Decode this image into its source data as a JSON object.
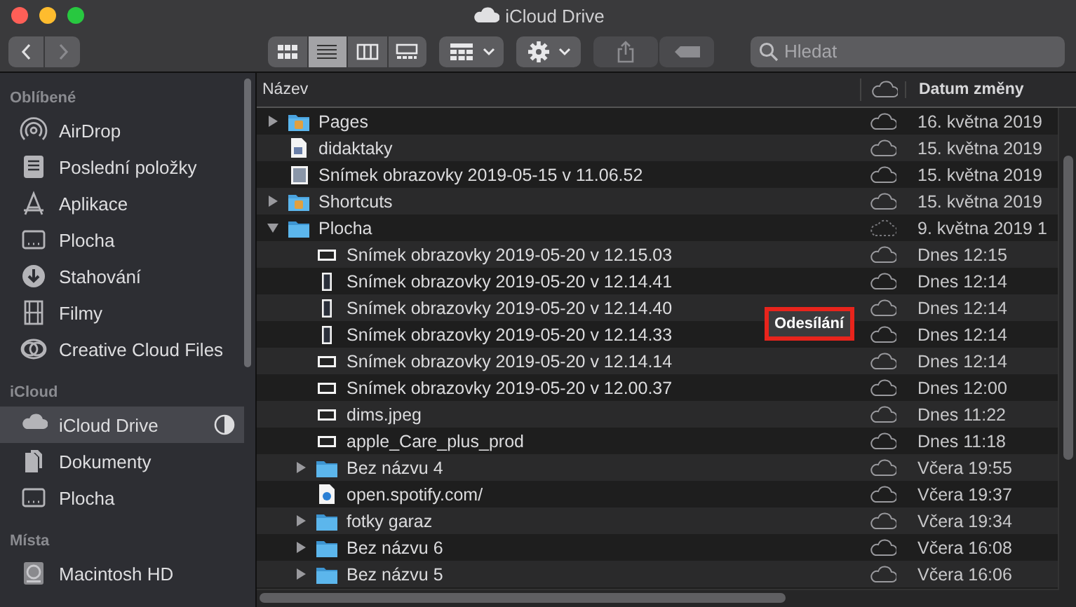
{
  "window": {
    "title": "iCloud Drive"
  },
  "toolbar": {
    "navigation": [
      {
        "kind": "back",
        "disabled": false
      },
      {
        "kind": "forward",
        "disabled": true
      }
    ],
    "view_modes": [
      {
        "kind": "icons",
        "selected": false
      },
      {
        "kind": "list",
        "selected": true
      },
      {
        "kind": "columns",
        "selected": false
      },
      {
        "kind": "gallery",
        "selected": false
      }
    ],
    "buttons": [
      {
        "kind": "group",
        "disabled": false
      },
      {
        "kind": "action",
        "disabled": false
      },
      {
        "kind": "share",
        "disabled": true
      },
      {
        "kind": "tags",
        "disabled": true
      }
    ],
    "search": {
      "placeholder": "Hledat"
    }
  },
  "sidebar": {
    "sections": [
      {
        "heading": "Oblíbené",
        "items": [
          {
            "label": "AirDrop",
            "kind": "airdrop",
            "selected": false,
            "syncing": false
          },
          {
            "label": "Poslední položky",
            "kind": "recents",
            "selected": false,
            "syncing": false
          },
          {
            "label": "Aplikace",
            "kind": "apps",
            "selected": false,
            "syncing": false
          },
          {
            "label": "Plocha",
            "kind": "desktop",
            "selected": false,
            "syncing": false
          },
          {
            "label": "Stahování",
            "kind": "downloads",
            "selected": false,
            "syncing": false
          },
          {
            "label": "Filmy",
            "kind": "movies",
            "selected": false,
            "syncing": false
          },
          {
            "label": "Creative Cloud Files",
            "kind": "rings",
            "selected": false,
            "syncing": false
          }
        ]
      },
      {
        "heading": "iCloud",
        "items": [
          {
            "label": "iCloud Drive",
            "kind": "cloud",
            "selected": true,
            "syncing": true
          },
          {
            "label": "Dokumenty",
            "kind": "documents",
            "selected": false,
            "syncing": false
          },
          {
            "label": "Plocha",
            "kind": "desktop",
            "selected": false,
            "syncing": false
          }
        ]
      },
      {
        "heading": "Místa",
        "items": [
          {
            "label": "Macintosh HD",
            "kind": "disk",
            "selected": false,
            "syncing": false
          }
        ]
      }
    ]
  },
  "table": {
    "columns": [
      {
        "kind": "name",
        "label": "Název"
      },
      {
        "kind": "status"
      },
      {
        "kind": "date",
        "label": "Datum změny"
      }
    ],
    "rows": [
      {
        "name": "Pages",
        "kind": "app-folder",
        "expanded": false,
        "pending": false,
        "modified": "16. května 2019"
      },
      {
        "name": "didaktaky",
        "kind": "document",
        "pending": false,
        "modified": "15. května 2019"
      },
      {
        "name": "Snímek obrazovky 2019-05-15 v 11.06.52",
        "kind": "image",
        "pending": false,
        "modified": "15. května 2019"
      },
      {
        "name": "Shortcuts",
        "kind": "app-folder",
        "expanded": false,
        "pending": false,
        "modified": "15. května 2019"
      },
      {
        "name": "Plocha",
        "kind": "folder",
        "expanded": true,
        "pending": true,
        "modified": "9. května 2019 1",
        "children": [
          {
            "name": "Snímek obrazovky 2019-05-20 v 12.15.03",
            "kind": "image-wide",
            "pending": false,
            "modified": "Dnes 12:15"
          },
          {
            "name": "Snímek obrazovky 2019-05-20 v 12.14.41",
            "kind": "image-tall",
            "pending": false,
            "modified": "Dnes 12:14"
          },
          {
            "name": "Snímek obrazovky 2019-05-20 v 12.14.40",
            "kind": "image-tall",
            "pending": false,
            "modified": "Dnes 12:14"
          },
          {
            "name": "Snímek obrazovky 2019-05-20 v 12.14.33",
            "kind": "image-tall",
            "pending": false,
            "modified": "Dnes 12:14"
          },
          {
            "name": "Snímek obrazovky 2019-05-20 v 12.14.14",
            "kind": "image-wide",
            "pending": false,
            "modified": "Dnes 12:14"
          },
          {
            "name": "Snímek obrazovky 2019-05-20 v 12.00.37",
            "kind": "image-wide",
            "pending": false,
            "modified": "Dnes 12:00"
          },
          {
            "name": "dims.jpeg",
            "kind": "image-wide",
            "pending": false,
            "modified": "Dnes 11:22"
          },
          {
            "name": "apple_Care_plus_prod",
            "kind": "image-wide",
            "pending": false,
            "modified": "Dnes 11:18"
          },
          {
            "name": "Bez názvu 4",
            "kind": "folder",
            "expanded": false,
            "pending": false,
            "modified": "Včera 19:55"
          },
          {
            "name": "open.spotify.com/",
            "kind": "link",
            "pending": false,
            "modified": "Včera 19:37"
          },
          {
            "name": "fotky garaz",
            "kind": "folder",
            "expanded": false,
            "pending": false,
            "modified": "Včera 19:34"
          },
          {
            "name": "Bez názvu 6",
            "kind": "folder",
            "expanded": false,
            "pending": false,
            "modified": "Včera 16:08"
          },
          {
            "name": "Bez názvu 5",
            "kind": "folder",
            "expanded": false,
            "pending": false,
            "modified": "Včera 16:06"
          }
        ]
      }
    ]
  },
  "tooltip": {
    "text": "Odesílání",
    "highlighted": true
  }
}
